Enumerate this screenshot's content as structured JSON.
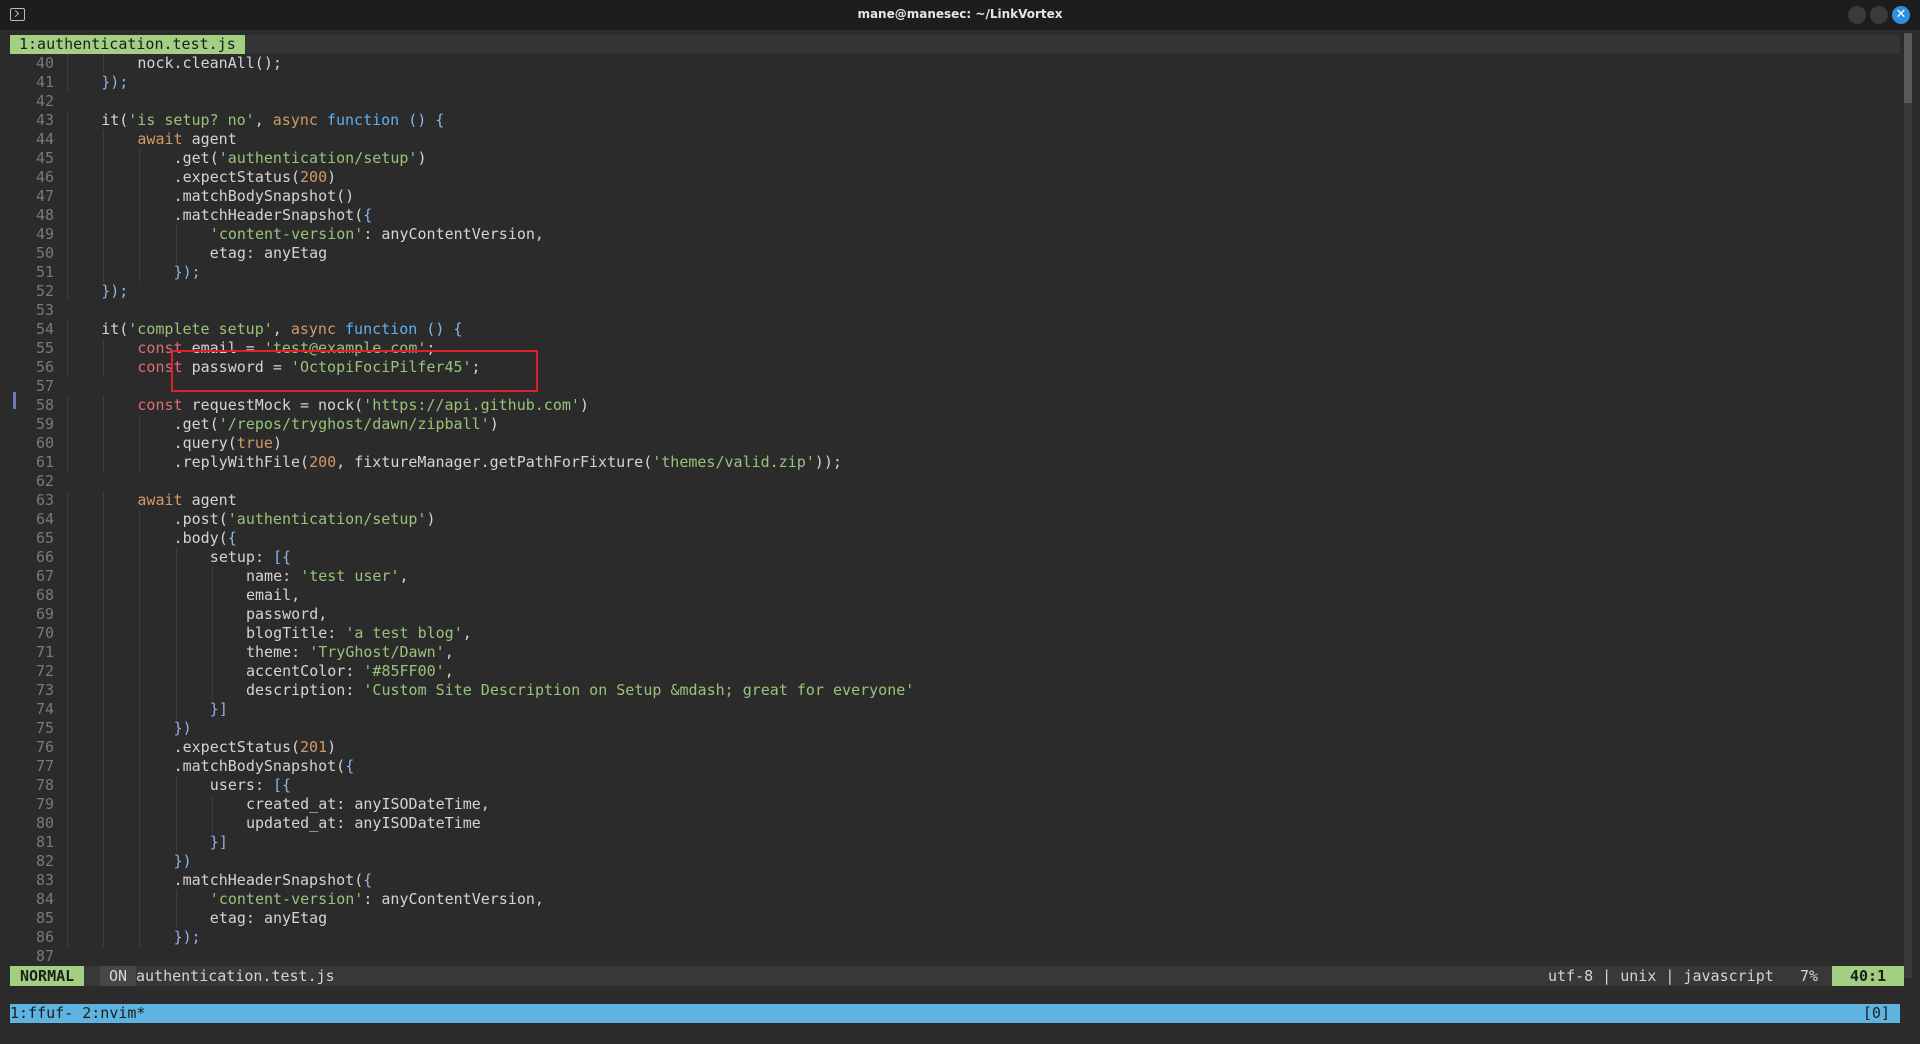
{
  "window": {
    "title": "mane@manesec: ~/LinkVortex"
  },
  "tabline": {
    "active_tab": "1:authentication.test.js"
  },
  "editor": {
    "lines": [
      {
        "n": "40",
        "indent": 8,
        "tokens": [
          {
            "t": "nock.cleanAll();",
            "c": "txt"
          }
        ]
      },
      {
        "n": "41",
        "indent": 4,
        "tokens": [
          {
            "t": "});",
            "c": "br"
          }
        ]
      },
      {
        "n": "42",
        "indent": 0,
        "tokens": []
      },
      {
        "n": "43",
        "indent": 4,
        "tokens": [
          {
            "t": "it(",
            "c": "txt"
          },
          {
            "t": "'is setup? no'",
            "c": "str"
          },
          {
            "t": ", ",
            "c": "txt"
          },
          {
            "t": "async",
            "c": "kw"
          },
          {
            "t": " ",
            "c": "txt"
          },
          {
            "t": "function",
            "c": "fn"
          },
          {
            "t": " () {",
            "c": "br"
          }
        ]
      },
      {
        "n": "44",
        "indent": 8,
        "tokens": [
          {
            "t": "await",
            "c": "kw"
          },
          {
            "t": " agent",
            "c": "txt"
          }
        ]
      },
      {
        "n": "45",
        "indent": 12,
        "tokens": [
          {
            "t": ".get(",
            "c": "txt"
          },
          {
            "t": "'authentication/setup'",
            "c": "str"
          },
          {
            "t": ")",
            "c": "txt"
          }
        ]
      },
      {
        "n": "46",
        "indent": 12,
        "tokens": [
          {
            "t": ".expectStatus(",
            "c": "txt"
          },
          {
            "t": "200",
            "c": "num"
          },
          {
            "t": ")",
            "c": "txt"
          }
        ]
      },
      {
        "n": "47",
        "indent": 12,
        "tokens": [
          {
            "t": ".matchBodySnapshot()",
            "c": "txt"
          }
        ]
      },
      {
        "n": "48",
        "indent": 12,
        "tokens": [
          {
            "t": ".matchHeaderSnapshot(",
            "c": "txt"
          },
          {
            "t": "{",
            "c": "br"
          }
        ]
      },
      {
        "n": "49",
        "indent": 16,
        "tokens": [
          {
            "t": "'content-version'",
            "c": "str"
          },
          {
            "t": ": anyContentVersion,",
            "c": "txt"
          }
        ]
      },
      {
        "n": "50",
        "indent": 16,
        "tokens": [
          {
            "t": "etag: anyEtag",
            "c": "txt"
          }
        ]
      },
      {
        "n": "51",
        "indent": 12,
        "tokens": [
          {
            "t": "});",
            "c": "br"
          }
        ]
      },
      {
        "n": "52",
        "indent": 4,
        "tokens": [
          {
            "t": "});",
            "c": "br"
          }
        ]
      },
      {
        "n": "53",
        "indent": 0,
        "tokens": []
      },
      {
        "n": "54",
        "indent": 4,
        "tokens": [
          {
            "t": "it(",
            "c": "txt"
          },
          {
            "t": "'complete setup'",
            "c": "str"
          },
          {
            "t": ", ",
            "c": "txt"
          },
          {
            "t": "async",
            "c": "kw"
          },
          {
            "t": " ",
            "c": "txt"
          },
          {
            "t": "function",
            "c": "fn"
          },
          {
            "t": " () {",
            "c": "br"
          }
        ]
      },
      {
        "n": "55",
        "indent": 8,
        "tokens": [
          {
            "t": "const",
            "c": "kw2"
          },
          {
            "t": " email = ",
            "c": "txt"
          },
          {
            "t": "'test@example.com'",
            "c": "str"
          },
          {
            "t": ";",
            "c": "txt"
          }
        ]
      },
      {
        "n": "56",
        "indent": 8,
        "tokens": [
          {
            "t": "const",
            "c": "kw2"
          },
          {
            "t": " password = ",
            "c": "txt"
          },
          {
            "t": "'OctopiFociPilfer45'",
            "c": "str"
          },
          {
            "t": ";",
            "c": "txt"
          }
        ]
      },
      {
        "n": "57",
        "indent": 0,
        "tokens": []
      },
      {
        "n": "58",
        "indent": 8,
        "tokens": [
          {
            "t": "const",
            "c": "kw2"
          },
          {
            "t": " requestMock = nock(",
            "c": "txt"
          },
          {
            "t": "'https://api.github.com'",
            "c": "str"
          },
          {
            "t": ")",
            "c": "txt"
          }
        ]
      },
      {
        "n": "59",
        "indent": 12,
        "tokens": [
          {
            "t": ".get(",
            "c": "txt"
          },
          {
            "t": "'/repos/tryghost/dawn/zipball'",
            "c": "str"
          },
          {
            "t": ")",
            "c": "txt"
          }
        ]
      },
      {
        "n": "60",
        "indent": 12,
        "tokens": [
          {
            "t": ".query(",
            "c": "txt"
          },
          {
            "t": "true",
            "c": "num"
          },
          {
            "t": ")",
            "c": "txt"
          }
        ]
      },
      {
        "n": "61",
        "indent": 12,
        "tokens": [
          {
            "t": ".replyWithFile(",
            "c": "txt"
          },
          {
            "t": "200",
            "c": "num"
          },
          {
            "t": ", fixtureManager.getPathForFixture(",
            "c": "txt"
          },
          {
            "t": "'themes/valid.zip'",
            "c": "str"
          },
          {
            "t": "));",
            "c": "txt"
          }
        ]
      },
      {
        "n": "62",
        "indent": 0,
        "tokens": []
      },
      {
        "n": "63",
        "indent": 8,
        "tokens": [
          {
            "t": "await",
            "c": "kw"
          },
          {
            "t": " agent",
            "c": "txt"
          }
        ]
      },
      {
        "n": "64",
        "indent": 12,
        "tokens": [
          {
            "t": ".post(",
            "c": "txt"
          },
          {
            "t": "'authentication/setup'",
            "c": "str"
          },
          {
            "t": ")",
            "c": "txt"
          }
        ]
      },
      {
        "n": "65",
        "indent": 12,
        "tokens": [
          {
            "t": ".body(",
            "c": "txt"
          },
          {
            "t": "{",
            "c": "br"
          }
        ]
      },
      {
        "n": "66",
        "indent": 16,
        "tokens": [
          {
            "t": "setup: ",
            "c": "txt"
          },
          {
            "t": "[{",
            "c": "br"
          }
        ]
      },
      {
        "n": "67",
        "indent": 20,
        "tokens": [
          {
            "t": "name: ",
            "c": "txt"
          },
          {
            "t": "'test user'",
            "c": "str"
          },
          {
            "t": ",",
            "c": "txt"
          }
        ]
      },
      {
        "n": "68",
        "indent": 20,
        "tokens": [
          {
            "t": "email,",
            "c": "txt"
          }
        ]
      },
      {
        "n": "69",
        "indent": 20,
        "tokens": [
          {
            "t": "password,",
            "c": "txt"
          }
        ]
      },
      {
        "n": "70",
        "indent": 20,
        "tokens": [
          {
            "t": "blogTitle: ",
            "c": "txt"
          },
          {
            "t": "'a test blog'",
            "c": "str"
          },
          {
            "t": ",",
            "c": "txt"
          }
        ]
      },
      {
        "n": "71",
        "indent": 20,
        "tokens": [
          {
            "t": "theme: ",
            "c": "txt"
          },
          {
            "t": "'TryGhost/Dawn'",
            "c": "str"
          },
          {
            "t": ",",
            "c": "txt"
          }
        ]
      },
      {
        "n": "72",
        "indent": 20,
        "tokens": [
          {
            "t": "accentColor: ",
            "c": "txt"
          },
          {
            "t": "'#85FF00'",
            "c": "str"
          },
          {
            "t": ",",
            "c": "txt"
          }
        ]
      },
      {
        "n": "73",
        "indent": 20,
        "tokens": [
          {
            "t": "description: ",
            "c": "txt"
          },
          {
            "t": "'Custom Site Description on Setup &mdash; great for everyone'",
            "c": "str"
          }
        ]
      },
      {
        "n": "74",
        "indent": 16,
        "tokens": [
          {
            "t": "}]",
            "c": "br"
          }
        ]
      },
      {
        "n": "75",
        "indent": 12,
        "tokens": [
          {
            "t": "})",
            "c": "br"
          }
        ]
      },
      {
        "n": "76",
        "indent": 12,
        "tokens": [
          {
            "t": ".expectStatus(",
            "c": "txt"
          },
          {
            "t": "201",
            "c": "num"
          },
          {
            "t": ")",
            "c": "txt"
          }
        ]
      },
      {
        "n": "77",
        "indent": 12,
        "tokens": [
          {
            "t": ".matchBodySnapshot(",
            "c": "txt"
          },
          {
            "t": "{",
            "c": "br"
          }
        ]
      },
      {
        "n": "78",
        "indent": 16,
        "tokens": [
          {
            "t": "users: ",
            "c": "txt"
          },
          {
            "t": "[{",
            "c": "br"
          }
        ]
      },
      {
        "n": "79",
        "indent": 20,
        "tokens": [
          {
            "t": "created_at: anyISODateTime,",
            "c": "txt"
          }
        ]
      },
      {
        "n": "80",
        "indent": 20,
        "tokens": [
          {
            "t": "updated_at: anyISODateTime",
            "c": "txt"
          }
        ]
      },
      {
        "n": "81",
        "indent": 16,
        "tokens": [
          {
            "t": "}]",
            "c": "br"
          }
        ]
      },
      {
        "n": "82",
        "indent": 12,
        "tokens": [
          {
            "t": "})",
            "c": "br"
          }
        ]
      },
      {
        "n": "83",
        "indent": 12,
        "tokens": [
          {
            "t": ".matchHeaderSnapshot(",
            "c": "txt"
          },
          {
            "t": "{",
            "c": "br"
          }
        ]
      },
      {
        "n": "84",
        "indent": 16,
        "tokens": [
          {
            "t": "'content-version'",
            "c": "str"
          },
          {
            "t": ": anyContentVersion,",
            "c": "txt"
          }
        ]
      },
      {
        "n": "85",
        "indent": 16,
        "tokens": [
          {
            "t": "etag: anyEtag",
            "c": "txt"
          }
        ]
      },
      {
        "n": "86",
        "indent": 12,
        "tokens": [
          {
            "t": "});",
            "c": "br"
          }
        ]
      },
      {
        "n": "87",
        "indent": 0,
        "tokens": []
      }
    ]
  },
  "statusline": {
    "mode": "NORMAL",
    "flag": "ON",
    "filename": "authentication.test.js",
    "fileinfo": "utf-8 | unix | javascript",
    "percent": "7%",
    "position": "40:1"
  },
  "tmux": {
    "windows": "1:ffuf- 2:nvim*",
    "right": "[0]"
  },
  "colors": {
    "accent_green": "#a3cf82",
    "tmux_blue": "#5fb3e0",
    "highlight_box": "#e0202a"
  }
}
